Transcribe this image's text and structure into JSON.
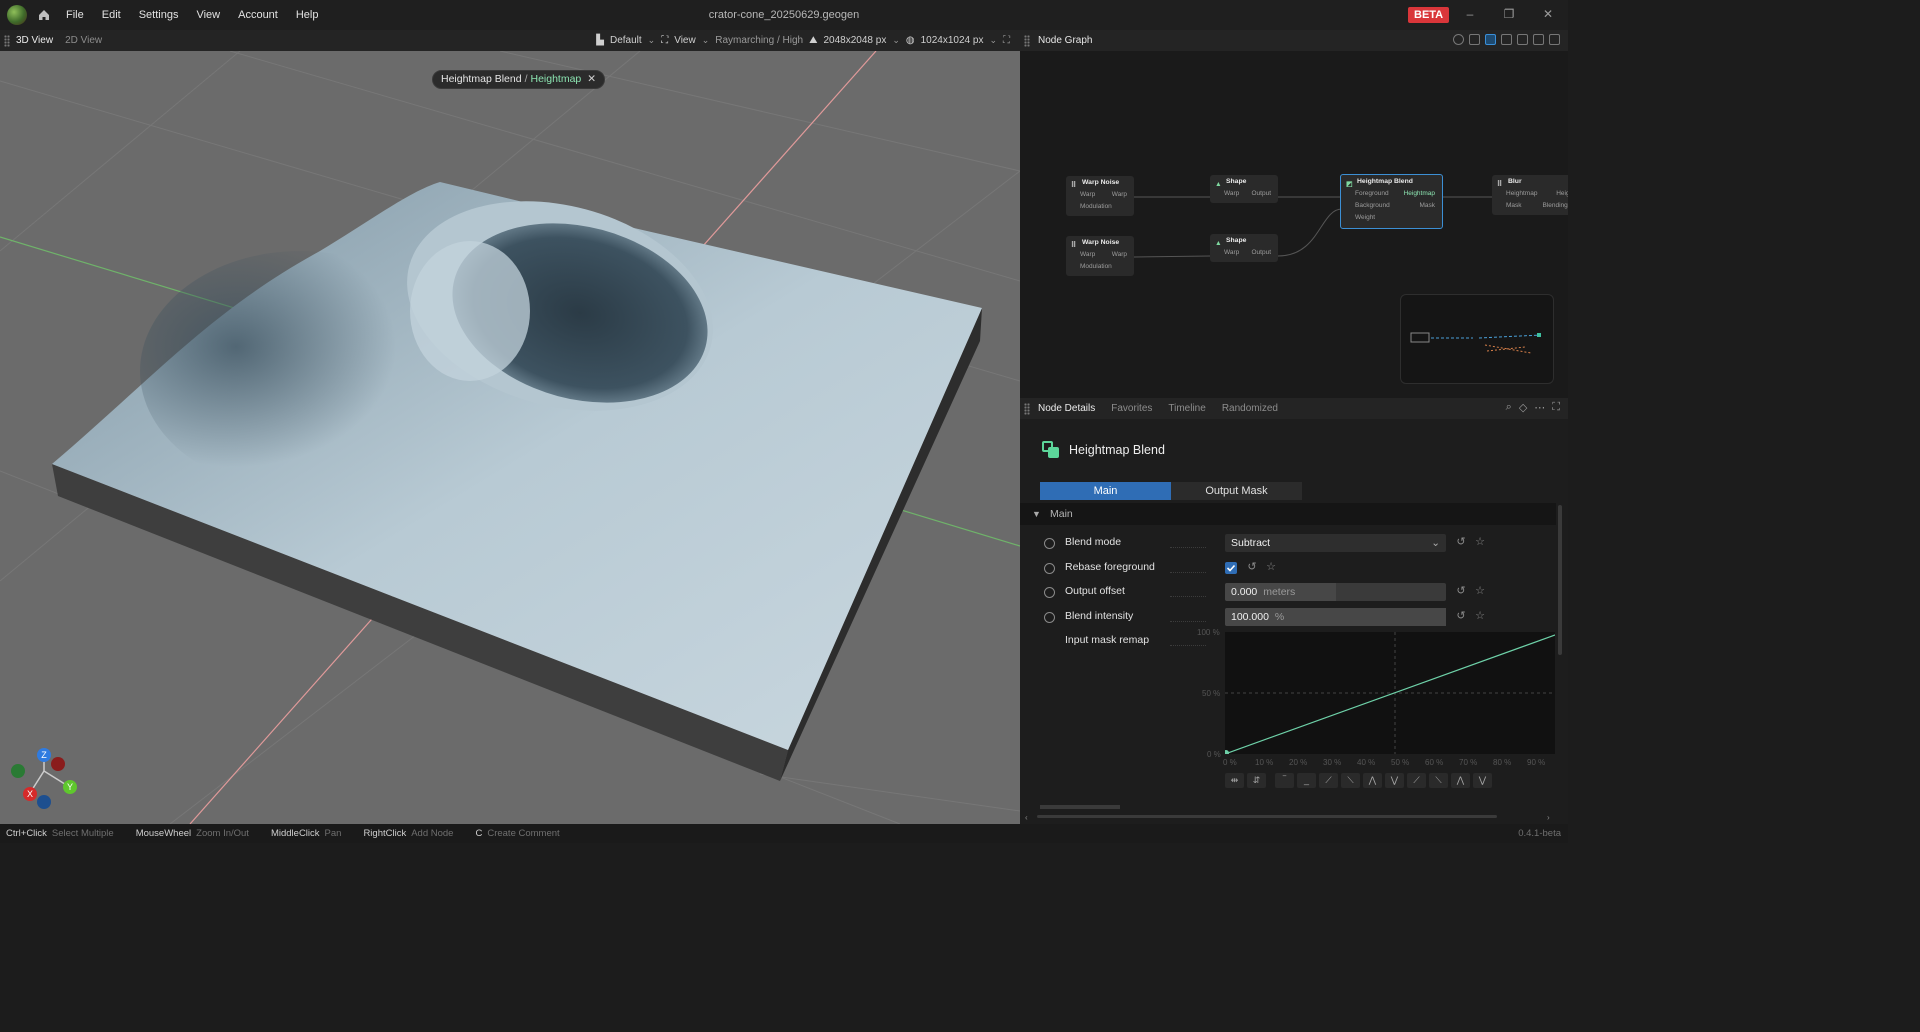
{
  "app": {
    "document_title": "crator-cone_20250629.geogen",
    "beta_label": "BETA",
    "menu": [
      "File",
      "Edit",
      "Settings",
      "View",
      "Account",
      "Help"
    ]
  },
  "viewport_toolbar": {
    "tabs": [
      "3D View",
      "2D View"
    ],
    "preset": "Default",
    "view": "View",
    "render_mode": "Raymarching / High",
    "resolution": "2048x2048 px",
    "preview_resolution": "1024x1024 px"
  },
  "viewport": {
    "breadcrumb_node": "Heightmap Blend",
    "breadcrumb_sep": "/",
    "breadcrumb_output": "Heightmap",
    "gizmo": {
      "z": "Z",
      "y": "Y",
      "x": "X"
    }
  },
  "node_graph": {
    "title": "Node Graph",
    "nodes": [
      {
        "title": "Warp Noise",
        "rows": [
          [
            "Warp",
            "Warp"
          ],
          [
            "Modulation",
            ""
          ]
        ]
      },
      {
        "title": "Warp Noise",
        "rows": [
          [
            "Warp",
            "Warp"
          ],
          [
            "Modulation",
            ""
          ]
        ]
      },
      {
        "title": "Shape",
        "rows": [
          [
            "Warp",
            "Output"
          ]
        ]
      },
      {
        "title": "Shape",
        "rows": [
          [
            "Warp",
            "Output"
          ]
        ]
      },
      {
        "title": "Heightmap Blend",
        "rows": [
          [
            "Foreground",
            "Heightmap"
          ],
          [
            "Background",
            "Mask"
          ],
          [
            "Weight",
            ""
          ]
        ]
      },
      {
        "title": "Blur",
        "rows": [
          [
            "Heightmap",
            "Height"
          ],
          [
            "Mask",
            "Blending M"
          ]
        ]
      }
    ]
  },
  "details": {
    "tabs": [
      "Node Details",
      "Favorites",
      "Timeline",
      "Randomized"
    ],
    "node_name": "Heightmap Blend",
    "subtabs": [
      "Main",
      "Output Mask"
    ],
    "section": "Main",
    "blend_mode": {
      "label": "Blend mode",
      "value": "Subtract"
    },
    "rebase_foreground": {
      "label": "Rebase foreground",
      "checked": true
    },
    "output_offset": {
      "label": "Output offset",
      "value": "0.000",
      "unit": "meters",
      "fraction": 0.5
    },
    "blend_intensity": {
      "label": "Blend intensity",
      "value": "100.000",
      "unit": "%",
      "fraction": 1.0
    },
    "input_mask_remap": {
      "label": "Input mask remap"
    },
    "curve": {
      "y_ticks": [
        "100 %",
        "50 %",
        "0 %"
      ],
      "x_ticks": [
        "0 %",
        "10 %",
        "20 %",
        "30 %",
        "40 %",
        "50 %",
        "60 %",
        "70 %",
        "80 %",
        "90 %"
      ]
    }
  },
  "status_bar": [
    {
      "key": "Ctrl+Click",
      "desc": "Select Multiple"
    },
    {
      "key": "MouseWheel",
      "desc": "Zoom In/Out"
    },
    {
      "key": "MiddleClick",
      "desc": "Pan"
    },
    {
      "key": "RightClick",
      "desc": "Add Node"
    },
    {
      "key": "C",
      "desc": "Create Comment"
    }
  ],
  "version": "0.4.1-beta",
  "colors": {
    "accent": "#2f6db5",
    "beta": "#d9363a",
    "active_output": "#8be3b0"
  }
}
